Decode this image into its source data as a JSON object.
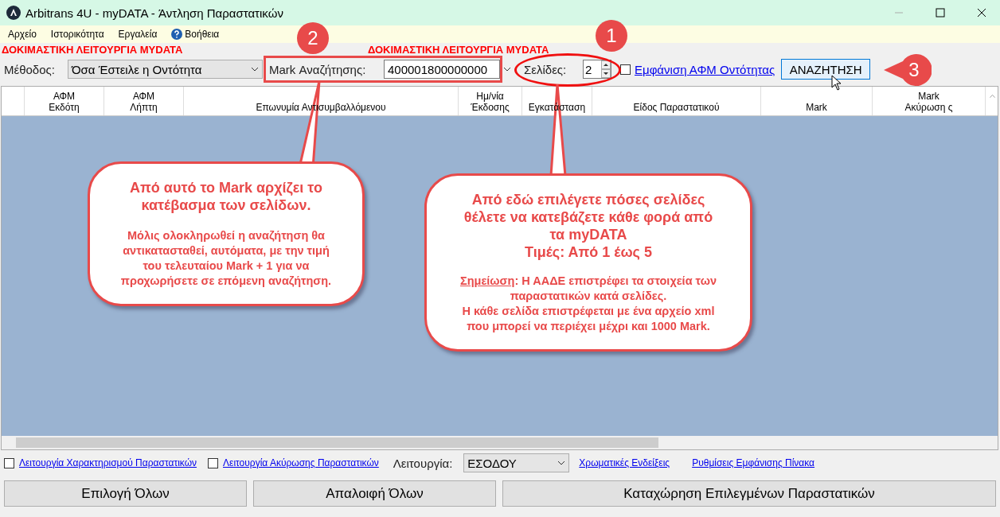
{
  "window": {
    "title": "Arbitrans 4U - myDATA - Άντληση Παραστατικών"
  },
  "menu": [
    {
      "label": "Αρχείο",
      "kind": "plain"
    },
    {
      "label": "Ιστορικότητα",
      "kind": "plain"
    },
    {
      "label": "Εργαλεία",
      "kind": "plain"
    },
    {
      "label": "Βοήθεια",
      "kind": "help"
    }
  ],
  "test_banners": [
    "ΔΟΚΙΜΑΣΤΙΚΗ ΛΕΙΤΟΥΡΓΙΑ MYDATA",
    "ΔΟΚΙΜΑΣΤΙΚΗ ΛΕΙΤΟΥΡΓΙΑ MYDATA"
  ],
  "toolbar": {
    "method": {
      "label": "Μέθοδος:",
      "value": "Όσα Έστειλε η Οντότητα"
    },
    "mark_search": {
      "label": "Mark Αναζήτησης:",
      "value": "400001800000000"
    },
    "pages": {
      "label": "Σελίδες:",
      "value": "2"
    },
    "show_afm": {
      "label": "Εμφάνιση ΑΦΜ Οντότητας",
      "checked": false
    },
    "search_button": "ΑΝΑΖΗΤΗΣΗ"
  },
  "table": {
    "columns": [
      [
        "ΑΦΜ",
        "Εκδότη"
      ],
      [
        "ΑΦΜ",
        "Λήπτη"
      ],
      [
        "Επωνυμία Αντισυμβαλλόμενου"
      ],
      [
        "Ημ/νία",
        "Έκδοσης"
      ],
      [
        "Εγκατάσταση"
      ],
      [
        "Είδος Παραστατικού"
      ],
      [
        "Mark"
      ],
      [
        "Mark",
        "Ακύρωση ς"
      ]
    ]
  },
  "options": {
    "characterization": {
      "label": "Λειτουργία Χαρακτηρισμού Παραστατικών",
      "checked": false
    },
    "cancellation": {
      "label": "Λειτουργία Ακύρωσης Παραστατικών",
      "checked": false
    },
    "mode": {
      "label": "Λειτουργία:",
      "value": "ΕΣΟΔΟΥ"
    },
    "links": [
      "Χρωματικές Ενδείξεις",
      "Ρυθμίσεις Εμφάνισης Πίνακα"
    ]
  },
  "buttons": [
    "Επιλογή Όλων",
    "Απαλοιφή Όλων",
    "Καταχώρηση Επιλεγμένων Παραστατικών"
  ],
  "annotations": [
    {
      "number": "2",
      "kind": "circle"
    },
    {
      "number": "1",
      "kind": "circle"
    },
    {
      "number": "3",
      "kind": "arrow"
    }
  ],
  "callouts": [
    {
      "title": "Από αυτό το Mark αρχίζει το κατέβασμα των σελίδων.",
      "paragraphs": [
        "Μόλις ολοκληρωθεί η αναζήτηση θα αντικατασταθεί, αυτόματα, με την τιμή του τελευταίου Mark + 1 για να προχωρήσετε σε επόμενη αναζήτηση."
      ]
    },
    {
      "title": "Από εδώ επιλέγετε πόσες σελίδες θέλετε να κατεβάζετε κάθε φορά από τα myDATA",
      "subtitle": "Τιμές: Από 1 έως 5",
      "note_label": "Σημείωση",
      "note_text": ": Η ΑΑΔΕ επιστρέφει τα στοιχεία των παραστατικών κατά σελίδες.",
      "paragraphs": [
        "Η κάθε σελίδα επιστρέφεται με ένα αρχείο xml που μπορεί να περιέχει μέχρι και 1000 Mark."
      ]
    }
  ]
}
